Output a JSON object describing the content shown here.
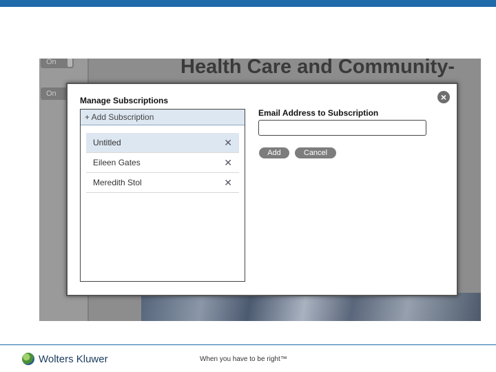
{
  "background": {
    "heading": "Health Care and Community-",
    "toggles": [
      "On",
      "On"
    ]
  },
  "modal": {
    "title": "Manage Subscriptions",
    "close_icon": "close-icon",
    "add_subscription_label": "+ Add Subscription",
    "subscriptions": [
      {
        "label": "Untitled",
        "selected": true
      },
      {
        "label": "Eileen Gates",
        "selected": false
      },
      {
        "label": "Meredith Stol",
        "selected": false
      }
    ],
    "remove_glyph": "✕",
    "email_label": "Email Address to Subscription",
    "email_value": "",
    "add_button": "Add",
    "cancel_button": "Cancel"
  },
  "footer": {
    "brand": "Wolters Kluwer",
    "tagline": "When you have to be right™"
  },
  "colors": {
    "topbar": "#1f6aa8",
    "selected_row": "#dde7f1"
  }
}
